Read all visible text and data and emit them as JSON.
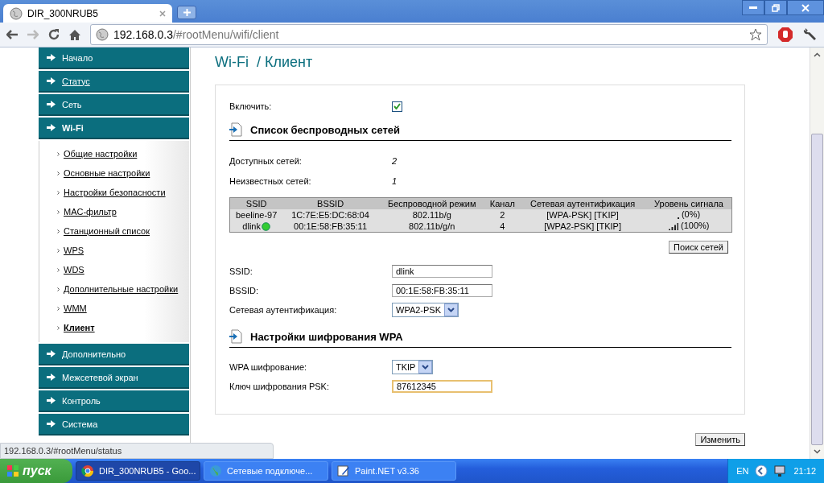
{
  "browser": {
    "tab_title": "DIR_300NRUB5",
    "url_host": "192.168.0.3",
    "url_path": "/#rootMenu/wifi/client",
    "status_url": "192.168.0.3/#rootMenu/status"
  },
  "sidebar": {
    "items": [
      {
        "label": "Начало",
        "kind": "section",
        "selected": false,
        "link": false
      },
      {
        "label": "Статус",
        "kind": "section",
        "selected": false,
        "link": true
      },
      {
        "label": "Сеть",
        "kind": "section",
        "selected": false,
        "link": false
      },
      {
        "label": "Wi-Fi",
        "kind": "section",
        "selected": true,
        "link": false,
        "children": [
          {
            "label": "Общие настройки",
            "selected": false
          },
          {
            "label": "Основные настройки",
            "selected": false
          },
          {
            "label": "Настройки безопасности",
            "selected": false
          },
          {
            "label": "MAC-фильтр",
            "selected": false
          },
          {
            "label": "Станционный список",
            "selected": false
          },
          {
            "label": "WPS",
            "selected": false
          },
          {
            "label": "WDS",
            "selected": false
          },
          {
            "label": "Дополнительные настройки",
            "selected": false
          },
          {
            "label": "WMM",
            "selected": false
          },
          {
            "label": "Клиент",
            "selected": true
          }
        ]
      },
      {
        "label": "Дополнительно",
        "kind": "section",
        "selected": false,
        "link": false
      },
      {
        "label": "Межсетевой экран",
        "kind": "section",
        "selected": false,
        "link": false
      },
      {
        "label": "Контроль",
        "kind": "section",
        "selected": false,
        "link": false
      },
      {
        "label": "Система",
        "kind": "section",
        "selected": false,
        "link": false
      }
    ]
  },
  "page": {
    "title": "Wi-Fi  / Клиент",
    "enable": {
      "label": "Включить:",
      "checked": true
    },
    "network_list": {
      "heading": "Список беспроводных сетей",
      "stats": [
        {
          "label": "Доступных сетей:",
          "value": "2"
        },
        {
          "label": "Неизвестных сетей:",
          "value": "1"
        }
      ],
      "columns": [
        "SSID",
        "BSSID",
        "Беспроводной режим",
        "Канал",
        "Сетевая аутентификация",
        "Уровень сигнала"
      ],
      "rows": [
        {
          "ssid": "beeline-97",
          "connected": false,
          "bssid": "1C:7E:E5:DC:68:04",
          "mode": "802.11b/g",
          "channel": "2",
          "auth": "[WPA-PSK] [TKIP]",
          "kind": "weak",
          "signal_text": "(0%)"
        },
        {
          "ssid": "dlink",
          "connected": true,
          "bssid": "00:1E:58:FB:35:11",
          "mode": "802.11b/g/n",
          "channel": "4",
          "auth": "[WPA2-PSK] [TKIP]",
          "kind": "strong",
          "signal_text": "(100%)"
        }
      ],
      "scan_button": "Поиск сетей"
    },
    "fields": [
      {
        "label": "SSID:",
        "kind": "text",
        "value": "dlink",
        "focused": false
      },
      {
        "label": "BSSID:",
        "kind": "text",
        "value": "00:1E:58:FB:35:11",
        "focused": false
      },
      {
        "label": "Сетевая аутентификация:",
        "kind": "select",
        "value": "WPA2-PSK"
      }
    ],
    "wpa": {
      "heading": "Настройки шифрования WPA",
      "fields": [
        {
          "label": "WPA шифрование:",
          "kind": "select",
          "value": "TKIP"
        },
        {
          "label": "Ключ шифрования PSK:",
          "kind": "text",
          "value": "87612345",
          "focused": true
        }
      ]
    },
    "apply_button": "Изменить"
  },
  "taskbar": {
    "start": "пуск",
    "tasks": [
      {
        "label": "DIR_300NRUB5 - Goo...",
        "selected": true
      },
      {
        "label": "Сетевые подключе...",
        "selected": false
      },
      {
        "label": "Paint.NET v3.36",
        "selected": false
      }
    ],
    "language": "EN",
    "time": "21:12"
  }
}
